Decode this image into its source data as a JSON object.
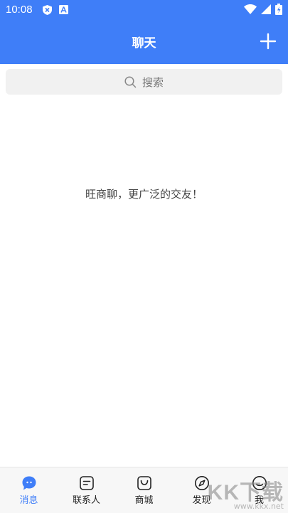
{
  "status_bar": {
    "time": "10:08"
  },
  "header": {
    "title": "聊天"
  },
  "search": {
    "placeholder": "搜索"
  },
  "empty_state": {
    "message": "旺商聊，更广泛的交友！"
  },
  "tabbar": {
    "active_color": "#3f7ef8",
    "items": [
      {
        "label": "消息",
        "icon": "chat-bubble-icon"
      },
      {
        "label": "联系人",
        "icon": "contacts-icon"
      },
      {
        "label": "商城",
        "icon": "shopping-bag-icon"
      },
      {
        "label": "发现",
        "icon": "compass-icon"
      },
      {
        "label": "我",
        "icon": "smiley-profile-icon"
      }
    ]
  },
  "watermark": {
    "brand": "KK下载",
    "url": "www.kkx.net"
  },
  "colors": {
    "header_bg": "#3f7ef8",
    "search_bg": "#f1f1f1"
  }
}
